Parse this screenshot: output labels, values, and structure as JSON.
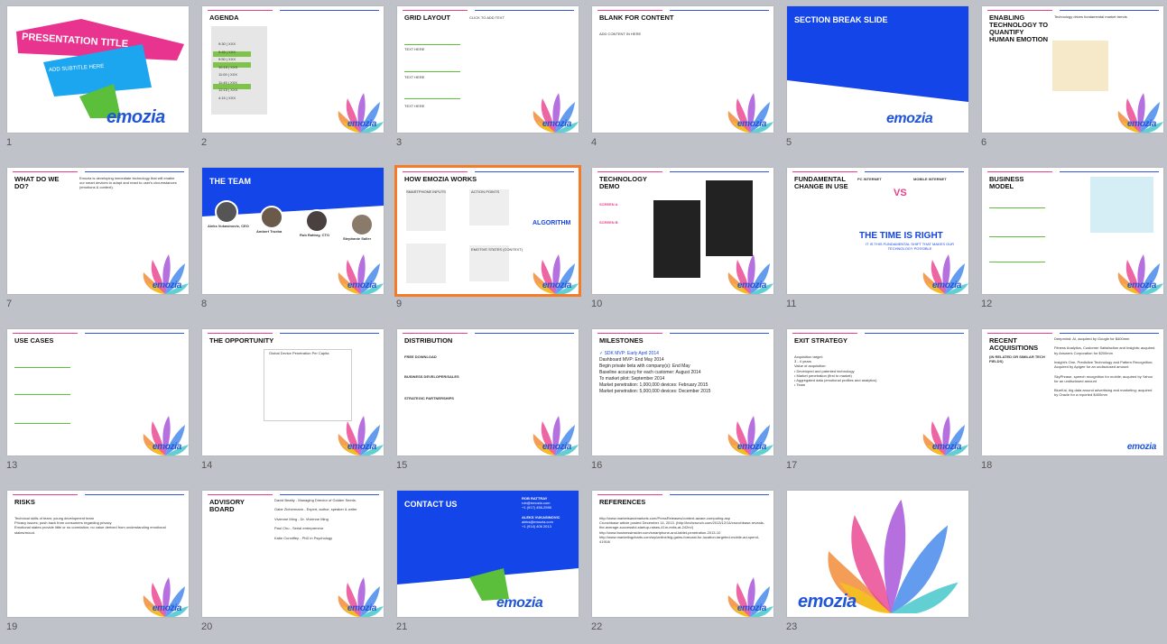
{
  "colors": {
    "accent_blue": "#1345e8",
    "pink": "#e83e8c",
    "green": "#5bbf3c",
    "selection": "#f47c28",
    "background": "#bfc2c8"
  },
  "slides": [
    {
      "num": "1",
      "title": "PRESENTATION TITLE",
      "subtitle": "ADD SUBTITLE HERE",
      "logo": "emozia"
    },
    {
      "num": "2",
      "title": "AGENDA",
      "agenda": [
        "9:30 | XXX",
        "9:45 | XXX",
        "9:50 | XXX",
        "10:15 | XXX",
        "11:00 | XXX",
        "11:45 | XXX",
        "12:15 | XXX",
        "4:15 | XXX"
      ],
      "logo": "emozia"
    },
    {
      "num": "3",
      "title": "GRID LAYOUT",
      "click": "CLICK TO ADD TEXT",
      "items": [
        "TEXT HERE",
        "TEXT HERE",
        "TEXT HERE"
      ],
      "logo": "emozia"
    },
    {
      "num": "4",
      "title": "BLANK FOR CONTENT",
      "body": "ADD CONTENT IN HERE",
      "logo": "emozia"
    },
    {
      "num": "5",
      "title": "SECTION BREAK SLIDE",
      "logo": "emozia"
    },
    {
      "num": "6",
      "title": "ENABLING TECHNOLOGY TO QUANTIFY HUMAN EMOTION",
      "body": "Technology drives fundamental market trends",
      "logo": "emozia"
    },
    {
      "num": "7",
      "title": "WHAT DO WE DO?",
      "body": "Emozia is developing immediate technology that will enable our smart devices to adapt and react to user's circumstances (emotions & context).",
      "logo": "emozia"
    },
    {
      "num": "8",
      "title": "THE TEAM",
      "people": [
        {
          "name": "Aleks Vukasinovic, CEO"
        },
        {
          "name": "Ambert Trueba"
        },
        {
          "name": "Rob Rattray, CTO"
        },
        {
          "name": "Stephanie Saller"
        }
      ],
      "logo": "emozia"
    },
    {
      "num": "9",
      "title": "HOW EMOZIA WORKS",
      "algo": "ALGORITHM",
      "boxes": [
        "SMARTPHONE INPUTS",
        "ACTION POINTS",
        "EMOTIVE STATES (CONTEXT)"
      ],
      "logo": "emozia"
    },
    {
      "num": "10",
      "title": "TECHNOLOGY DEMO",
      "screen_a": "SCREEN A",
      "screen_b": "SCREEN B",
      "logo": "emozia"
    },
    {
      "num": "11",
      "title": "FUNDAMENTAL CHANGE IN USE",
      "left": "PC INTERNET",
      "right": "MOBILE INTERNET",
      "vs": "VS",
      "big": "THE TIME IS RIGHT",
      "sub": "IT IS THIS FUNDAMENTAL SHIFT THAT MAKES OUR TECHNOLOGY POSSIBLE",
      "logo": "emozia"
    },
    {
      "num": "12",
      "title": "BUSINESS MODEL",
      "logo": "emozia"
    },
    {
      "num": "13",
      "title": "USE CASES",
      "logo": "emozia"
    },
    {
      "num": "14",
      "title": "THE OPPORTUNITY",
      "chart_title": "Global Device Penetration Per Capita",
      "logo": "emozia"
    },
    {
      "num": "15",
      "title": "DISTRIBUTION",
      "p1": "FREE DOWNLOAD",
      "p2": "BUSINESS DEVELOPER/SALES",
      "p3": "STRATEGIC PARTNERSHIPS",
      "logo": "emozia"
    },
    {
      "num": "16",
      "title": "MILESTONES",
      "lines": [
        "SDK MVP: Early April 2014",
        "Dashboard MVP: End May 2014",
        "Begin private beta with company(s): End May",
        "Baseline accuracy for each customer: August 2014",
        "To market pilot: September 2014",
        "Market penetration: 1,000,000 devices: February 2015",
        "Market penetration: 5,000,000 devices: December 2015"
      ],
      "logo": "emozia"
    },
    {
      "num": "17",
      "title": "EXIT STRATEGY",
      "lines": [
        "Acquisition target:",
        "3 - 4 years",
        "Value of acquisition:",
        "Developed and patented technology",
        "Market penetration (first to market)",
        "Aggregated data (emotional profiles and analytics)",
        "Team"
      ],
      "logo": "emozia"
    },
    {
      "num": "18",
      "title": "RECENT ACQUISITIONS",
      "sub": "(IN RELATED OR SIMILAR TECH FIELDS)",
      "lines": [
        "Deepmind: AI, acquired by Google for $400mm",
        "Fitness Analytics, Customer Satisfaction and Insights; acquired by Answers Corporation for $200mm",
        "Insight's One, Predictive Technology and Pattern Recognition; Acquired by Apigee for an undisclosed amount",
        "SkyPhrase, speech recognition for mobile; acquired by Yahoo for an undisclosed amount",
        "BlueKai, big data around advertising and marketing; acquired by Oracle for a reported $400mm"
      ],
      "logo": "emozia"
    },
    {
      "num": "19",
      "title": "RISKS",
      "lines": [
        "Technical skills of team; young development team",
        "Privacy issues; push back from consumers regarding privacy",
        "Emotional states provide little or no correlation; no value derived from understanding emotional states/mood."
      ],
      "page": "19",
      "logo": "emozia"
    },
    {
      "num": "20",
      "title": "ADVISORY BOARD",
      "lines": [
        "David Beatty - Managing Director of Golden Seeds.",
        "Gabe Zichermann - Expert, author, speaker & writer",
        "Vivienne Ming - Dr. Vivienne Ming",
        "Paul Chu - Serial entrepreneur",
        "Katie Cunniffey - PhD in Psychology"
      ],
      "logo": "emozia"
    },
    {
      "num": "21",
      "title": "CONTACT US",
      "c1_name": "ROB RATTRAY",
      "c1_email": "rob@emozia.com",
      "c1_phone": "+1 (917) 456-2590",
      "c2_name": "ALEKS VUKASINOVIC",
      "c2_email": "aleks@emozia.com",
      "c2_phone": "+1 (914) 406 2013",
      "logo": "emozia"
    },
    {
      "num": "22",
      "title": "REFERENCES",
      "lines": [
        "http://www.marketsandmarkets.com/PressReleases/context-aware-computing.asp",
        "Crunchbase article posted December 14, 2013. (http://techcrunch.com/2013/12/14/crunchbase-reveals-the-average-successful-startup-raises-41m-exits-at-242m/)",
        "http://www.businessinsider.com/smartphone-and-tablet-penetration-2013-10",
        "http://www.marketingcharts.com/wp/online/big-gains-forecast-for-location-targeted-mobile-ad-spend-41916/"
      ],
      "logo": "emozia"
    },
    {
      "num": "23",
      "logo": "emozia"
    }
  ]
}
